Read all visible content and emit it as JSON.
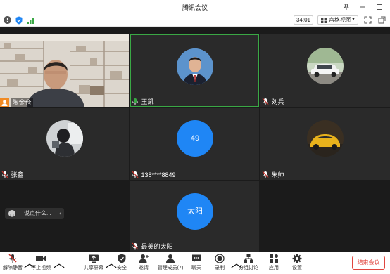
{
  "window": {
    "title": "腾讯会议"
  },
  "topbar": {
    "timer": "34:01",
    "view_label": "宫格视图"
  },
  "participants": [
    {
      "name": "陶金仓"
    },
    {
      "name": "王凯"
    },
    {
      "name": "刘兵"
    },
    {
      "name": "张鑫"
    },
    {
      "name": "138****8849",
      "avatar_text": "49"
    },
    {
      "name": "朱帅"
    },
    {
      "name": "最美的太阳",
      "avatar_text": "太阳"
    }
  ],
  "chat": {
    "placeholder": "说点什么..."
  },
  "toolbar": {
    "items": [
      {
        "label": "解除静音",
        "icon": "mic-muted-icon"
      },
      {
        "label": "停止视频",
        "icon": "video-icon"
      },
      {
        "label": "共享屏幕",
        "icon": "share-screen-icon"
      },
      {
        "label": "安全",
        "icon": "shield-icon"
      },
      {
        "label": "邀请",
        "icon": "invite-icon"
      },
      {
        "label": "管理成员(7)",
        "icon": "members-icon"
      },
      {
        "label": "聊天",
        "icon": "chat-icon"
      },
      {
        "label": "录制",
        "icon": "record-icon"
      },
      {
        "label": "分组讨论",
        "icon": "breakout-icon"
      },
      {
        "label": "应用",
        "icon": "apps-icon"
      },
      {
        "label": "设置",
        "icon": "settings-icon"
      }
    ],
    "end_label": "结束会议"
  },
  "colors": {
    "accent": "#1f86f5",
    "active_speaker": "#3aa845",
    "end": "#e0463f",
    "muted": "#c8322b"
  }
}
